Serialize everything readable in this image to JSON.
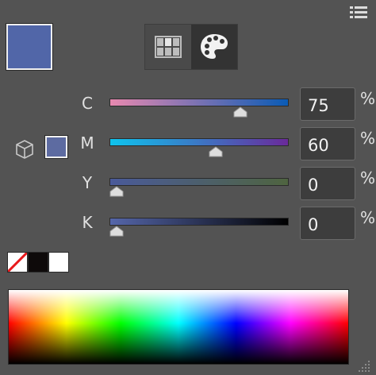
{
  "colors": {
    "fill": "#5166a8",
    "fill_small": "#5d6ba1",
    "panel_bg": "#535353"
  },
  "icons": {
    "panel_menu": "panel-menu-icon",
    "swatches_tab": "swatches-grid-icon",
    "palette_tab": "palette-icon",
    "gamut": "cube-icon",
    "none": "none-slash-icon",
    "resize": "resize-grip-icon"
  },
  "channels": [
    {
      "label": "C",
      "value": "75",
      "unit": "%",
      "level": 0.75,
      "gradient": [
        "#e889b0",
        "#0a5bb5"
      ]
    },
    {
      "label": "M",
      "value": "60",
      "unit": "%",
      "level": 0.6,
      "gradient": [
        "#0ec4ee",
        "#6a2a9a"
      ]
    },
    {
      "label": "Y",
      "value": "0",
      "unit": "%",
      "level": 0.0,
      "gradient": [
        "#4a5a9a",
        "#4f6440"
      ]
    },
    {
      "label": "K",
      "value": "0",
      "unit": "%",
      "level": 0.0,
      "gradient": [
        "#5566aa",
        "#000000"
      ]
    }
  ],
  "quick_swatches": [
    "none",
    "#0e0a0a",
    "#ffffff"
  ]
}
